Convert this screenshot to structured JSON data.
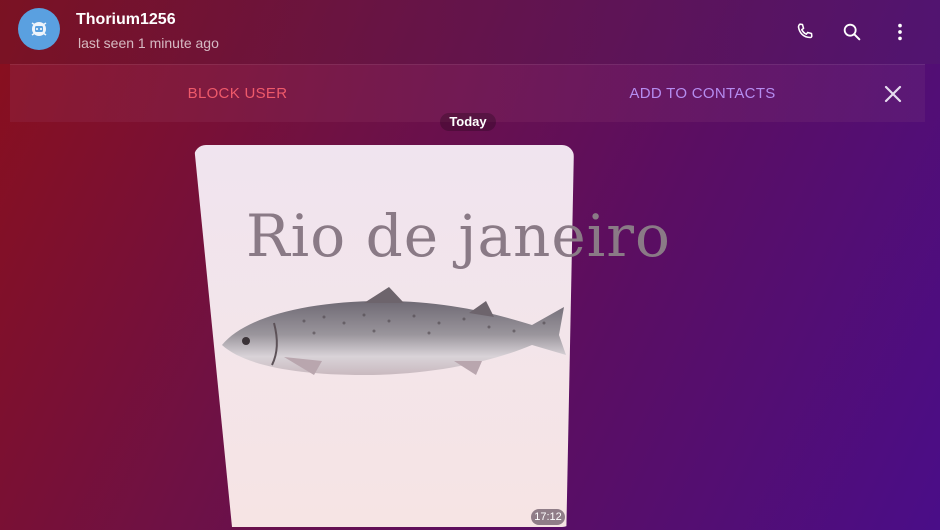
{
  "header": {
    "title": "Thorium1256",
    "subtitle": "last seen 1 minute ago",
    "icons": [
      "phone-icon",
      "search-icon",
      "more-vert-icon"
    ]
  },
  "actions": {
    "block_label": "BLOCK USER",
    "add_label": "ADD TO CONTACTS"
  },
  "chat": {
    "date": "Today",
    "image_caption": "Rio de janeiro",
    "time": "17:12"
  },
  "colors": {
    "block": "#ef5a6a",
    "add": "#b58cf0",
    "avatar": "#5aa0e0"
  }
}
